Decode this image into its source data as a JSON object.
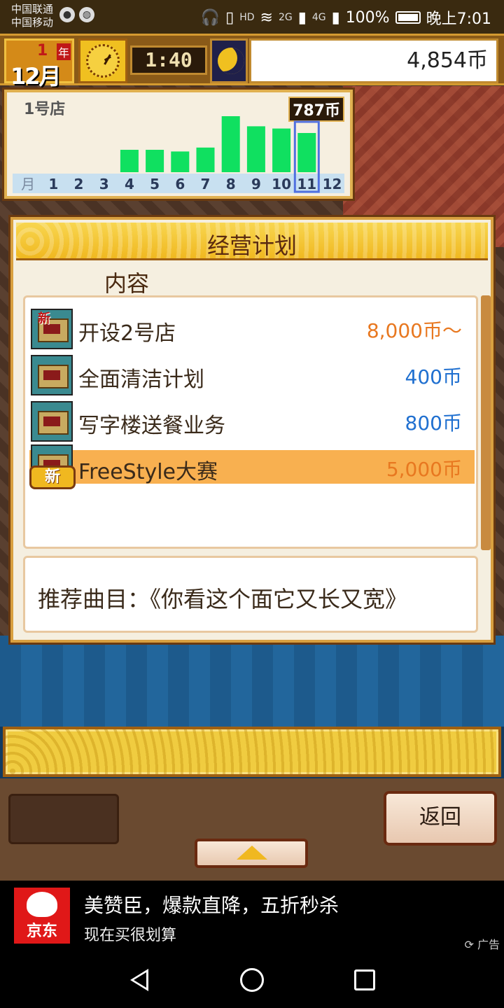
{
  "status_bar": {
    "carrier_1": "中国联通",
    "carrier_2": "中国移动",
    "net_2g": "2G",
    "net_4g": "4G",
    "hd_label": "HD",
    "battery": "100%",
    "time": "晚上7:01"
  },
  "hud": {
    "year": "1",
    "year_unit": "年",
    "month": "12月",
    "time": "1:40",
    "money": "4,854币",
    "clock_icon": "clock-icon",
    "night_icon": "moon-icon"
  },
  "chart": {
    "title": "1号店",
    "total": "787币",
    "x_axis_label": "月",
    "highlight_month": "11",
    "bar_color": "#10e060"
  },
  "chart_data": {
    "type": "bar",
    "title": "1号店",
    "categories": [
      "1",
      "2",
      "3",
      "4",
      "5",
      "6",
      "7",
      "8",
      "9",
      "10",
      "11",
      "12"
    ],
    "values": [
      0,
      0,
      0,
      40,
      40,
      37,
      44,
      100,
      82,
      78,
      70,
      0
    ],
    "xlabel": "月",
    "ylabel": "",
    "ylim": [
      0,
      100
    ],
    "grid": false
  },
  "plan": {
    "title": "经营计划",
    "subtitle": "内容",
    "items": [
      {
        "label": "开设2号店",
        "price": "8,000币～",
        "price_color": "#e87820",
        "new": true,
        "badge": ""
      },
      {
        "label": "全面清洁计划",
        "price": "400币",
        "price_color": "#2070d0",
        "new": false,
        "badge": ""
      },
      {
        "label": "写字楼送餐业务",
        "price": "800币",
        "price_color": "#2070d0",
        "new": false,
        "badge": ""
      },
      {
        "label": "FreeStyle大赛",
        "price": "5,000币",
        "price_color": "#e87820",
        "new": false,
        "badge": "新"
      }
    ],
    "new_tag": "新",
    "song": "推荐曲目：《你看这个面它又长又宽》"
  },
  "controls": {
    "back_label": "返回"
  },
  "ad": {
    "brand": "京东",
    "title": "美赞臣，爆款直降，五折秒杀",
    "subtitle": "现在买很划算",
    "tag": "广告"
  },
  "colors": {
    "accent_gold": "#f0b820",
    "selected_row": "#f8b050",
    "price_orange": "#e87820",
    "price_blue": "#2070d0"
  }
}
